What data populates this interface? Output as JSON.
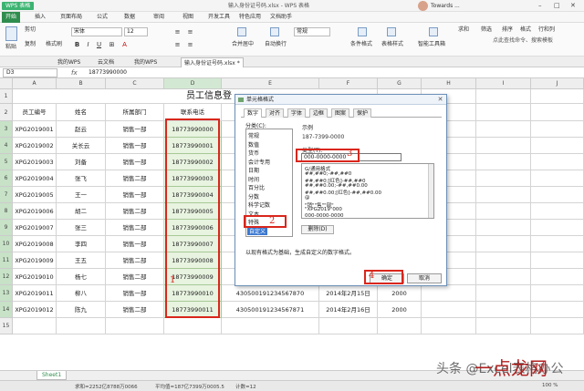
{
  "titlebar": {
    "app": "WPS 表格",
    "doc_title": "输入身份证号码.xlsx - WPS 表格",
    "user": "Towards ..."
  },
  "menu": [
    "开始",
    "插入",
    "页面布局",
    "公式",
    "数据",
    "审阅",
    "视图",
    "开发工具",
    "特色应用",
    "文档助手"
  ],
  "ribbon": {
    "paste": "粘贴",
    "cut": "剪切",
    "copy": "复制",
    "format_painter": "格式刷",
    "font": "宋体",
    "font_size": "12",
    "merge": "合并居中",
    "wrap": "自动换行",
    "format": "常规",
    "conditional": "条件格式",
    "table_style": "表格样式",
    "sum": "求和",
    "filter": "筛选",
    "sort": "排序",
    "fmt": "格式",
    "rowcol": "行和列",
    "smart": "智能工具箱",
    "tips": "点此查找命令、搜索模板"
  },
  "tabs": [
    "我的WPS",
    "云文档",
    "我的WPS",
    "输入身份证号码.xlsx *"
  ],
  "formula": {
    "cell": "D3",
    "value": "18773990000"
  },
  "columns": [
    "A",
    "B",
    "C",
    "D",
    "E",
    "F",
    "G",
    "H",
    "I",
    "J"
  ],
  "sheet_title": "员工信息登",
  "headers": [
    "员工编号",
    "姓名",
    "所属部门",
    "联系电话"
  ],
  "rows": [
    [
      "XPG2019001",
      "赵云",
      "销售一部",
      "18773990000"
    ],
    [
      "XPG2019002",
      "关长云",
      "销售一部",
      "18773990001"
    ],
    [
      "XPG2019003",
      "刘备",
      "销售一部",
      "18773990002"
    ],
    [
      "XPG2019004",
      "张飞",
      "销售二部",
      "18773990003"
    ],
    [
      "XPG2019005",
      "王一",
      "销售一部",
      "18773990004"
    ],
    [
      "XPG2019006",
      "胡二",
      "销售二部",
      "18773990005"
    ],
    [
      "XPG2019007",
      "张三",
      "销售二部",
      "18773990006"
    ],
    [
      "XPG2019008",
      "李四",
      "销售一部",
      "18773990007"
    ],
    [
      "XPG2019009",
      "王五",
      "销售二部",
      "18773990008"
    ],
    [
      "XPG2019010",
      "杨七",
      "销售二部",
      "18773990009"
    ],
    [
      "XPG2019011",
      "柳八",
      "销售一部",
      "18773990010"
    ],
    [
      "XPG2019012",
      "陈九",
      "销售二部",
      "18773990011"
    ]
  ],
  "visible_extra": {
    "row13": [
      "430500191234567870",
      "2014年2月15日",
      "2000"
    ],
    "row14": [
      "430500191234567871",
      "2014年2月16日",
      "2000"
    ]
  },
  "row_numbers": [
    "1",
    "2",
    "3",
    "4",
    "5",
    "6",
    "7",
    "8",
    "9",
    "10",
    "11",
    "12",
    "13",
    "14",
    "15"
  ],
  "dialog": {
    "title": "单元格格式",
    "tabs": [
      "数字",
      "对齐",
      "字体",
      "边框",
      "图案",
      "保护"
    ],
    "category_label": "分类(C):",
    "categories": [
      "常规",
      "数值",
      "货币",
      "会计专用",
      "日期",
      "时间",
      "百分比",
      "分数",
      "科学记数",
      "文本",
      "特殊",
      "自定义"
    ],
    "sample_label": "示例",
    "sample_value": "187-7399-0000",
    "type_label": "类型(T):",
    "type_value": "000-0000-0000",
    "formats": [
      "G/通用格式",
      "##,##0;-##,##0",
      "##,##0;[红色]-##,##0",
      "##,##0.00;-##,##0.00",
      "##,##0.00;[红色]-##,##0.00",
      "@",
      "\"销\"\"售\"\"部\"",
      "\"XPG2019\"000",
      "000-0000-0000"
    ],
    "delete_btn": "删除(D)",
    "description": "以现有格式为基础，生成自定义的数字格式。",
    "ok": "确定",
    "cancel": "取消"
  },
  "annotations": [
    "1",
    "2",
    "3",
    "4"
  ],
  "sheet_tab": "Sheet1",
  "status": {
    "sum": "求和=2252亿8788万0066",
    "avg": "平均值=187亿7399万0005.5",
    "count": "计数=12",
    "zoom": "100 %"
  },
  "watermark": "头条 @Excel表格办公",
  "watermark_logo": "一点龙网"
}
